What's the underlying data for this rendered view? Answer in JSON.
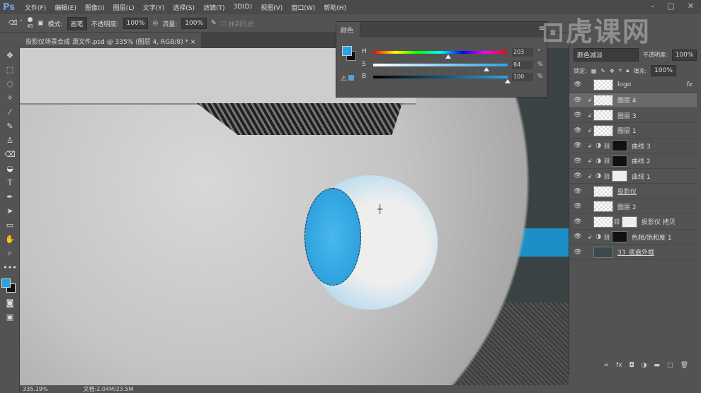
{
  "app": {
    "logo": "Ps",
    "menu": [
      "文件(F)",
      "编辑(E)",
      "图像(I)",
      "图层(L)",
      "文字(Y)",
      "选择(S)",
      "滤镜(T)",
      "3D(D)",
      "视图(V)",
      "窗口(W)",
      "帮助(H)"
    ]
  },
  "options": {
    "brush_size": "45",
    "mode_label": "模式:",
    "mode_value": "画笔",
    "opacity_label": "不透明度:",
    "opacity_value": "100%",
    "flow_label": "流量:",
    "flow_value": "100%",
    "erase_history": "抹到历史"
  },
  "document": {
    "tab_title": "投影仪场景合成  源文件.psd @ 335% (图层 4, RGB/8) *",
    "close": "×"
  },
  "status": {
    "zoom": "335.19%",
    "doc_size": "文档:2.04M/23.5M"
  },
  "color_panel": {
    "tab": "颜色",
    "h_label": "H",
    "h_value": "203",
    "h_unit": "°",
    "h_fraction": 0.56,
    "s_label": "S",
    "s_value": "84",
    "s_unit": "%",
    "s_fraction": 0.84,
    "b_label": "B",
    "b_value": "100",
    "b_unit": "%",
    "b_fraction": 1.0,
    "foreground": "#29a3ea",
    "background": "#111111"
  },
  "layers_panel": {
    "blend_mode": "颜色减淡",
    "opacity_label": "不透明度:",
    "opacity_value": "100%",
    "lock_label": "锁定:",
    "fill_label": "填充:",
    "fill_value": "100%",
    "layers": [
      {
        "name": "logo",
        "fx": "fx"
      },
      {
        "name": "图层 4"
      },
      {
        "name": "图层 3"
      },
      {
        "name": "图层 1"
      },
      {
        "name": "曲线 3"
      },
      {
        "name": "曲线 2"
      },
      {
        "name": "曲线 1"
      },
      {
        "name": "投影仪"
      },
      {
        "name": "图层 2"
      },
      {
        "name": "投影仪 拷贝"
      },
      {
        "name": "色相/饱和度 1"
      },
      {
        "name": "33_底盘外框"
      }
    ]
  },
  "watermark": "虎课网"
}
